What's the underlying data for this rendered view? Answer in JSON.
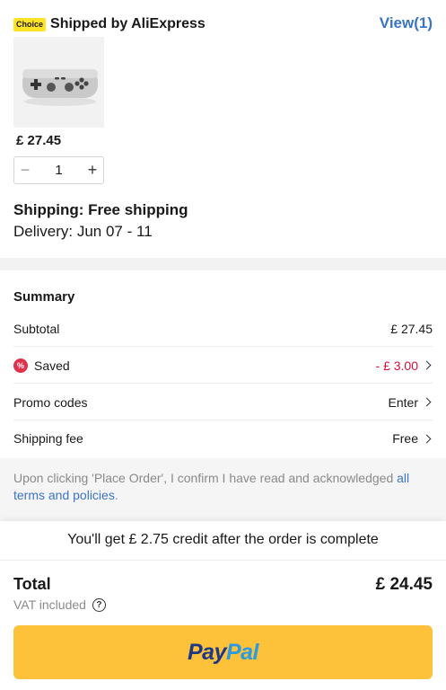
{
  "shipment": {
    "badge": "Choice",
    "title": "Shipped by AliExpress",
    "view_link": "View(1)"
  },
  "product": {
    "image_icon": "gamepad-controller-image",
    "price": "£ 27.45",
    "quantity": "1",
    "decrement_icon": "minus-icon",
    "increment_icon": "plus-icon"
  },
  "delivery": {
    "shipping": "Shipping: Free shipping",
    "eta": "Delivery: Jun 07 - 11"
  },
  "summary": {
    "title": "Summary",
    "rows": [
      {
        "label": "Subtotal",
        "value": "£ 27.45"
      },
      {
        "label": "Saved",
        "value": "- £ 3.00",
        "icon": "percent-badge-icon"
      },
      {
        "label": "Promo codes",
        "value": "Enter"
      },
      {
        "label": "Shipping fee",
        "value": "Free"
      }
    ]
  },
  "consent": {
    "text": "Upon clicking 'Place Order', I confirm I have read and acknowledged ",
    "link": "all terms and policies",
    "end": "."
  },
  "footer": {
    "credit": "You'll get  £ 2.75 credit after the order is complete",
    "total_label": "Total",
    "total_value": "£ 24.45",
    "vat": "VAT included",
    "help_icon": "?",
    "pay_brand_a": "Pay",
    "pay_brand_b": "Pal"
  },
  "colors": {
    "accent_link": "#3a74c7",
    "saved_red": "#d3103c",
    "paypal_button": "#fec13a",
    "choice_badge": "#ffe324"
  }
}
